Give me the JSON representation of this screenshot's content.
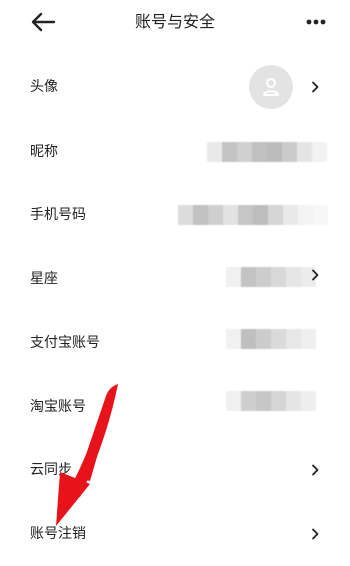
{
  "header": {
    "title": "账号与安全",
    "back_icon": "arrow-left-icon",
    "more_icon": "more-dots-icon"
  },
  "rows": [
    {
      "label": "头像",
      "trailing": "avatar"
    },
    {
      "label": "昵称",
      "trailing": "mosaic"
    },
    {
      "label": "手机号码",
      "trailing": "mosaic"
    },
    {
      "label": "星座",
      "trailing": "mosaic"
    },
    {
      "label": "支付宝账号",
      "trailing": "mosaic"
    },
    {
      "label": "淘宝账号",
      "trailing": "mosaic"
    },
    {
      "label": "云同步",
      "trailing": "none"
    },
    {
      "label": "账号注销",
      "trailing": "none"
    }
  ],
  "colors": {
    "annotation_arrow": "#e8121b",
    "mosaic_light": "#eeeeee",
    "mosaic_dark": "#b9b9b9",
    "avatar_bg": "#e3e3e3"
  }
}
